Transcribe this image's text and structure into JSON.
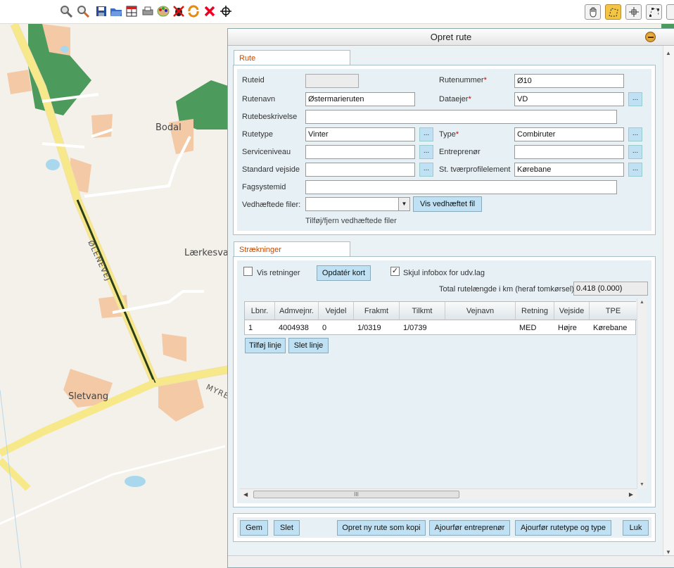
{
  "toolbar": {
    "left_icons": [
      "zoom-in-icon",
      "zoom-out-icon",
      "save-icon",
      "open-folder-icon",
      "table-icon",
      "print-icon",
      "palette-icon",
      "bug-icon",
      "refresh-icon",
      "delete-icon",
      "crosshair-icon"
    ],
    "right_icons": [
      "pan-hand-icon",
      "select-route-icon",
      "move-icon",
      "edit-vertices-icon",
      "more-icon"
    ]
  },
  "map": {
    "places": [
      "Bodal",
      "Lærkesva",
      "Sletvang"
    ],
    "roads": [
      "ØLENEVEJ",
      "MYRE"
    ]
  },
  "dialog": {
    "title": "Opret rute",
    "rute_tab": "Rute",
    "fields": {
      "ruteid_label": "Ruteid",
      "ruteid_value": "",
      "rutenummer_label": "Rutenummer",
      "rutenummer_value": "Ø10",
      "rutenavn_label": "Rutenavn",
      "rutenavn_value": "Østermarieruten",
      "dataejer_label": "Dataejer",
      "dataejer_value": "VD",
      "rutebeskrivelse_label": "Rutebeskrivelse",
      "rutebeskrivelse_value": "",
      "rutetype_label": "Rutetype",
      "rutetype_value": "Vinter",
      "type_label": "Type",
      "type_value": "Combiruter",
      "serviceniveau_label": "Serviceniveau",
      "serviceniveau_value": "",
      "entreprenor_label": "Entreprenør",
      "entreprenor_value": "",
      "standard_vejside_label": "Standard vejside",
      "standard_vejside_value": "",
      "tvaerprofil_label": "St. tværprofilelement",
      "tvaerprofil_value": "Kørebane",
      "fagsystemid_label": "Fagsystemid",
      "fagsystemid_value": "",
      "vedhaeftede_label": "Vedhæftede filer:",
      "vedhaeftede_value": "",
      "vis_vedhaeftet_button": "Vis vedhæftet fil",
      "tilfoj_fjern_link": "Tilføj/fjern vedhæftede filer",
      "dots": "..."
    },
    "straekninger": {
      "tab": "Strækninger",
      "vis_retninger_label": "Vis retninger",
      "vis_retninger_checked": false,
      "opdater_kort_button": "Opdatér kort",
      "skjul_infobox_label": "Skjul infobox for udv.lag",
      "skjul_infobox_checked": true,
      "check_mark": "✓",
      "total_label": "Total rutelængde i km (heraf tomkørsel)",
      "total_value": "0.418 (0.000)",
      "columns": [
        "Lbnr.",
        "Admvejnr.",
        "Vejdel",
        "Frakmt",
        "Tilkmt",
        "Vejnavn",
        "Retning",
        "Vejside",
        "TPE"
      ],
      "rows": [
        [
          "1",
          "4004938",
          "0",
          "1/0319",
          "1/0739",
          "",
          "MED",
          "Højre",
          "Kørebane"
        ]
      ],
      "tilfoj_linje_button": "Tilføj linje",
      "slet_linje_button": "Slet linje",
      "hscroll_grip": "III"
    },
    "footer": {
      "gem": "Gem",
      "slet": "Slet",
      "opret_kopi": "Opret ny rute som kopi",
      "ajourfor_entreprenor": "Ajourfør entreprenør",
      "ajourfor_rutetype": "Ajourfør rutetype og type",
      "luk": "Luk"
    }
  }
}
